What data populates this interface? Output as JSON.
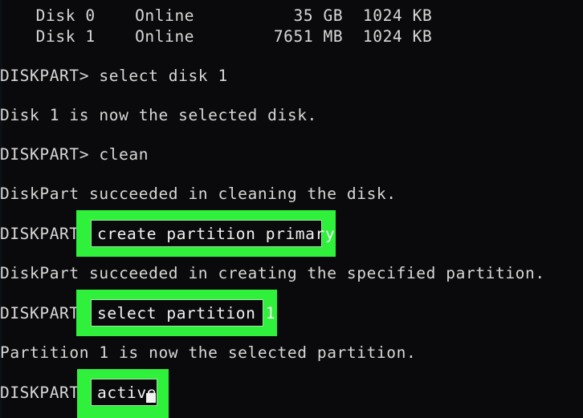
{
  "terminal": {
    "app": "DiskPart",
    "background_color": "#0a0a0c",
    "text_color": "#d8d8d8",
    "highlight_color": "#2ff03a",
    "callout_border_color": "#9fe6a5",
    "prompt": "DISKPART>",
    "disk_table": {
      "rows": [
        {
          "disk": "Disk 0",
          "status": "Online",
          "size": "35 GB",
          "free": "1024 KB"
        },
        {
          "disk": "Disk 1",
          "status": "Online",
          "size": "7651 MB",
          "free": "1024 KB"
        }
      ],
      "row0_text": "  Disk 0    Online          35 GB  1024 KB",
      "row1_text": "  Disk 1    Online        7651 MB  1024 KB"
    },
    "lines": [
      {
        "id": "prompt-select-disk",
        "text": "DISKPART> select disk 1"
      },
      {
        "id": "output-disk-selected",
        "text": "Disk 1 is now the selected disk."
      },
      {
        "id": "prompt-clean",
        "text": "DISKPART> clean"
      },
      {
        "id": "output-clean-success",
        "text": "DiskPart succeeded in cleaning the disk."
      },
      {
        "id": "prompt-create-partition",
        "text": "DISKPART"
      },
      {
        "id": "output-create-success",
        "text": "DiskPart succeeded in creating the specified partition."
      },
      {
        "id": "prompt-select-partition",
        "text": "DISKPART"
      },
      {
        "id": "output-partition-selected",
        "text": "Partition 1 is now the selected partition."
      },
      {
        "id": "prompt-active",
        "text": "DISKPART"
      }
    ],
    "highlighted_commands": [
      {
        "id": "create-partition-primary",
        "text": "create partition primary"
      },
      {
        "id": "select-partition-1",
        "text": "select partition 1"
      },
      {
        "id": "active",
        "text": "active"
      }
    ]
  }
}
